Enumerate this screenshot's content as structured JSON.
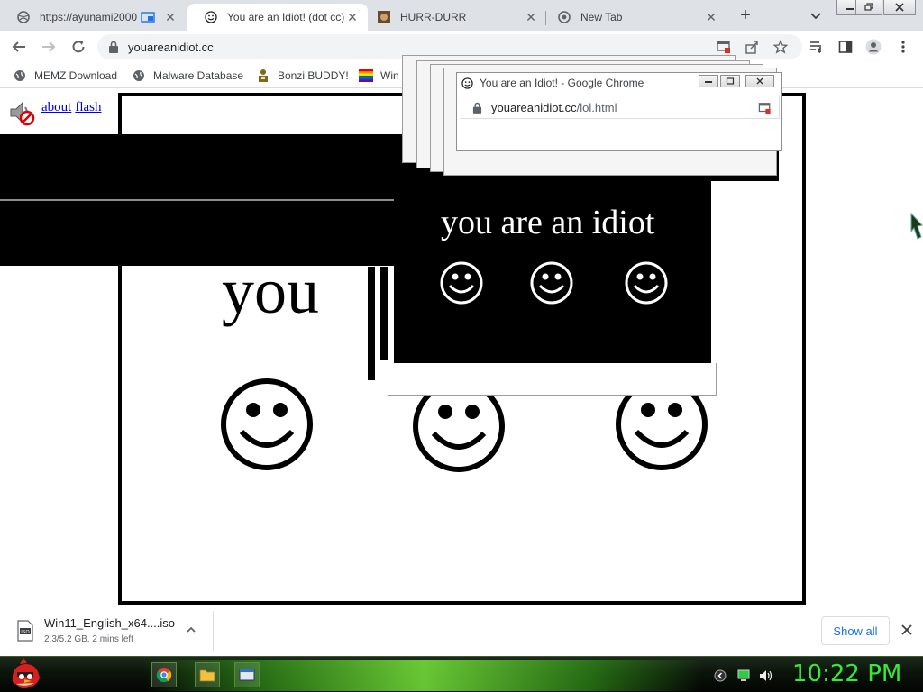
{
  "tabs": [
    {
      "title": "https://ayunami2000",
      "active": false
    },
    {
      "title": "You are an Idiot! (dot cc)",
      "active": true
    },
    {
      "title": "HURR-DURR",
      "active": false
    },
    {
      "title": "New Tab",
      "active": false
    }
  ],
  "toolbar": {
    "url": "youareanidiot.cc"
  },
  "bookmarks": [
    {
      "label": "MEMZ Download"
    },
    {
      "label": "Malware Database"
    },
    {
      "label": "Bonzi BUDDY!"
    },
    {
      "label": "Win"
    }
  ],
  "page": {
    "about_label": "about",
    "flash_label": "flash",
    "big_text": "you"
  },
  "popup": {
    "title": "You are an Idiot! - Google Chrome",
    "url_host": "youareanidiot.cc",
    "url_path": "/lol.html",
    "body_text": "you are an idiot"
  },
  "download": {
    "filename": "Win11_English_x64....iso",
    "status": "2.3/5.2 GB, 2 mins left",
    "show_all": "Show all"
  },
  "taskbar": {
    "clock": "10:22 PM"
  },
  "colors": {
    "clock_green": "#39e639",
    "link_blue": "#0000ee",
    "showall_blue": "#1a73e8"
  }
}
